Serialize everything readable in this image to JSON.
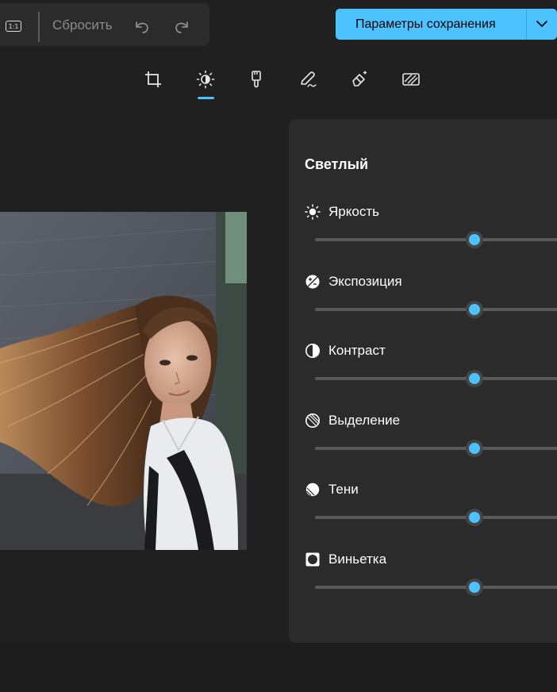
{
  "toolbar": {
    "ratio_label": "1:1",
    "reset_label": "Сбросить",
    "save_label": "Параметры сохранения"
  },
  "tabs": [
    {
      "name": "crop-icon"
    },
    {
      "name": "brightness-adjust-icon",
      "active": true
    },
    {
      "name": "filter-brush-icon"
    },
    {
      "name": "markup-pen-icon"
    },
    {
      "name": "eraser-icon"
    },
    {
      "name": "background-blur-icon"
    }
  ],
  "panel": {
    "title": "Светлый",
    "adjustments": [
      {
        "label": "Яркость",
        "icon": "sun-icon",
        "value": 0.59
      },
      {
        "label": "Экспозиция",
        "icon": "exposure-icon",
        "value": 0.59
      },
      {
        "label": "Контраст",
        "icon": "contrast-icon",
        "value": 0.59
      },
      {
        "label": "Выделение",
        "icon": "highlights-icon",
        "value": 0.59
      },
      {
        "label": "Тени",
        "icon": "shadows-icon",
        "value": 0.59
      },
      {
        "label": "Виньетка",
        "icon": "vignette-icon",
        "value": 0.59
      }
    ]
  },
  "colors": {
    "accent": "#4cc2ff",
    "background": "#202020",
    "panel": "#2b2b2b"
  }
}
